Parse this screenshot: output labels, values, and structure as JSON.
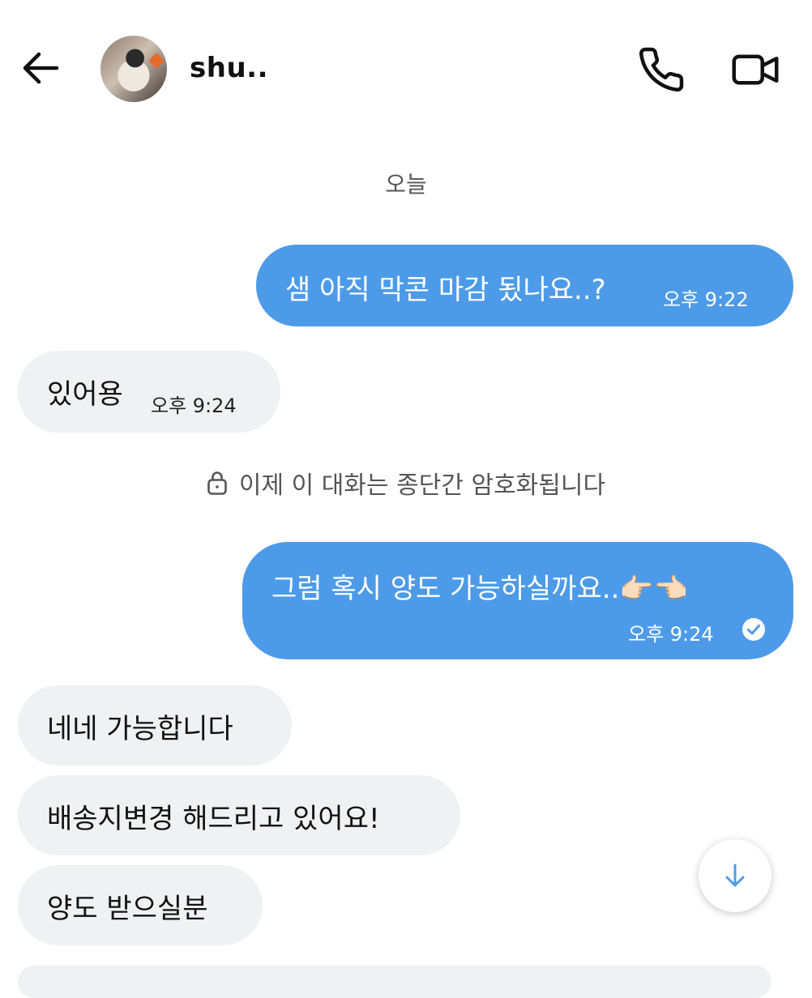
{
  "header": {
    "contact_name": "shu..",
    "back_icon": "arrow-left-icon",
    "call_icon": "phone-icon",
    "video_icon": "video-camera-icon"
  },
  "conversation": {
    "date_label": "오늘",
    "encryption_notice": "이제 이 대화는 종단간 암호화됩니다",
    "messages": [
      {
        "direction": "outgoing",
        "text": "샘 아직 막콘 마감 됬나요..?",
        "time": "오후 9:22"
      },
      {
        "direction": "incoming",
        "text": "있어용",
        "time": "오후 9:24"
      },
      {
        "direction": "outgoing",
        "text": "그럼 혹시 양도 가능하실까요..👉🏻👈🏻",
        "time": "오후 9:24",
        "status": "read"
      },
      {
        "direction": "incoming",
        "text": "네네 가능합니다"
      },
      {
        "direction": "incoming",
        "text": "배송지변경 해드리고 있어요!"
      },
      {
        "direction": "incoming",
        "text": "양도 받으실분"
      }
    ]
  },
  "scroll_button": {
    "icon": "arrow-down-icon"
  },
  "colors": {
    "outgoing_bubble": "#4d9be8",
    "incoming_bubble": "#eff1f3",
    "accent": "#4d9be8"
  }
}
